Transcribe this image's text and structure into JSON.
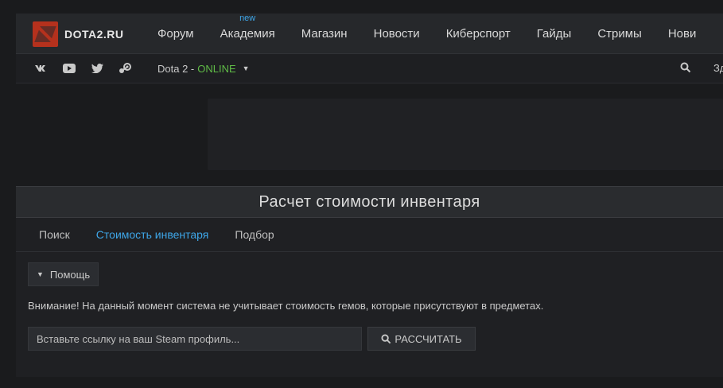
{
  "header": {
    "logo_text": "DOTA2.RU",
    "nav": [
      {
        "label": "Форум",
        "badge": ""
      },
      {
        "label": "Академия",
        "badge": "new"
      },
      {
        "label": "Магазин",
        "badge": ""
      },
      {
        "label": "Новости",
        "badge": ""
      },
      {
        "label": "Киберспорт",
        "badge": ""
      },
      {
        "label": "Гайды",
        "badge": ""
      },
      {
        "label": "Стримы",
        "badge": ""
      },
      {
        "label": "Нови",
        "badge": ""
      }
    ]
  },
  "subbar": {
    "social_icons": [
      "vk-icon",
      "youtube-icon",
      "twitter-icon",
      "steam-icon"
    ],
    "status_prefix": "Dota 2 -",
    "status_value": "ONLINE",
    "greeting": "Зд"
  },
  "panel": {
    "title": "Расчет стоимости инвентаря",
    "tabs": [
      {
        "label": "Поиск",
        "active": false
      },
      {
        "label": "Стоимость инвентаря",
        "active": true
      },
      {
        "label": "Подбор",
        "active": false
      }
    ],
    "help_label": "Помощь",
    "notice": "Внимание! На данный момент система не учитывает стоимость гемов, которые присутствуют в предметах.",
    "input_placeholder": "Вставьте ссылку на ваш Steam профиль...",
    "calc_label": "РАССЧИТАТЬ"
  },
  "colors": {
    "accent_blue": "#3ea6e8",
    "online_green": "#5fba46",
    "brand_red": "#b5311d"
  }
}
